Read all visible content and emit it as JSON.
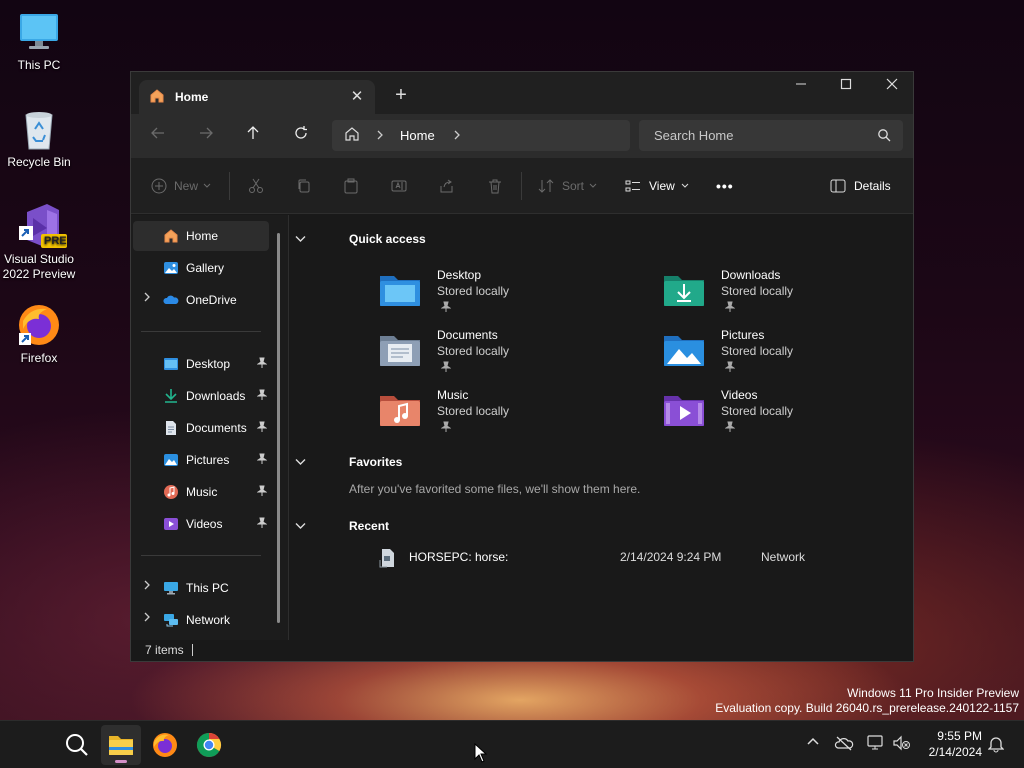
{
  "desktop": {
    "icons": [
      {
        "label": "This PC"
      },
      {
        "label": "Recycle Bin"
      },
      {
        "label": "Visual Studio 2022 Preview",
        "badge": "PRE"
      },
      {
        "label": "Firefox"
      }
    ]
  },
  "window": {
    "tab_title": "Home",
    "tab_close": "✕",
    "new_tab": "+",
    "controls": {
      "minimize": "—",
      "maximize": "☐",
      "close": "✕"
    },
    "address": {
      "crumbs": [
        "Home"
      ]
    },
    "search": {
      "placeholder": "Search Home"
    },
    "commands": {
      "new": "New",
      "sort": "Sort",
      "view": "View",
      "more": "•••",
      "details": "Details"
    },
    "sidebar": {
      "top": [
        {
          "label": "Home",
          "icon": "home-icon"
        },
        {
          "label": "Gallery",
          "icon": "gallery-icon"
        },
        {
          "label": "OneDrive",
          "icon": "onedrive-icon"
        }
      ],
      "pinned": [
        {
          "label": "Desktop",
          "icon": "desktop-folder-icon"
        },
        {
          "label": "Downloads",
          "icon": "downloads-folder-icon"
        },
        {
          "label": "Documents",
          "icon": "documents-folder-icon"
        },
        {
          "label": "Pictures",
          "icon": "pictures-folder-icon"
        },
        {
          "label": "Music",
          "icon": "music-folder-icon"
        },
        {
          "label": "Videos",
          "icon": "videos-folder-icon"
        }
      ],
      "bottom": [
        {
          "label": "This PC",
          "icon": "this-pc-icon"
        },
        {
          "label": "Network",
          "icon": "network-icon"
        }
      ]
    },
    "quick_access": {
      "heading": "Quick access",
      "items": [
        {
          "name": "Desktop",
          "sub": "Stored locally",
          "color": "#2f8fe0"
        },
        {
          "name": "Downloads",
          "sub": "Stored locally",
          "color": "#21a98a"
        },
        {
          "name": "Documents",
          "sub": "Stored locally",
          "color": "#8e9fb5"
        },
        {
          "name": "Pictures",
          "sub": "Stored locally",
          "color": "#2a8fe0"
        },
        {
          "name": "Music",
          "sub": "Stored locally",
          "color": "#e06a52"
        },
        {
          "name": "Videos",
          "sub": "Stored locally",
          "color": "#8a4fd6"
        }
      ]
    },
    "favorites": {
      "heading": "Favorites",
      "empty_text": "After you've favorited some files, we'll show them here."
    },
    "recent": {
      "heading": "Recent",
      "rows": [
        {
          "name": "HORSEPC: horse:",
          "date": "2/14/2024 9:24 PM",
          "location": "Network"
        }
      ]
    },
    "status": {
      "items": "7 items"
    }
  },
  "watermark": {
    "line1": "Windows 11 Pro Insider Preview",
    "line2": "Evaluation copy. Build 26040.rs_prerelease.240122-1157"
  },
  "taskbar": {
    "clock": {
      "time": "9:55 PM",
      "date": "2/14/2024"
    }
  }
}
